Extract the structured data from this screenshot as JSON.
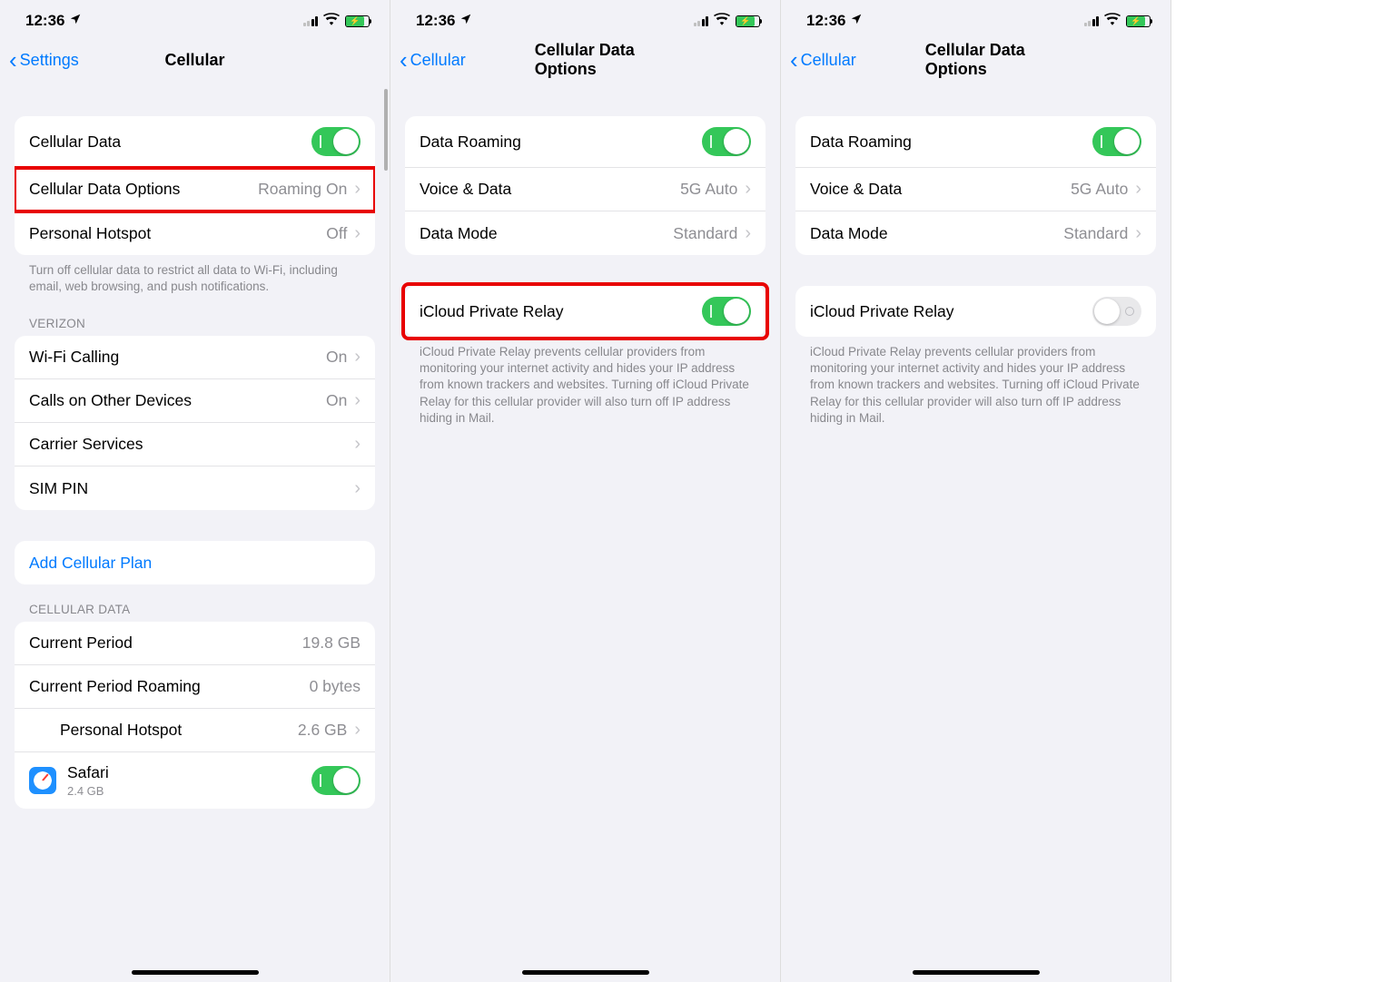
{
  "status": {
    "time": "12:36"
  },
  "screen1": {
    "back": "Settings",
    "title": "Cellular",
    "group1": {
      "cellular_data": "Cellular Data",
      "cellular_data_options": "Cellular Data Options",
      "cellular_data_options_detail": "Roaming On",
      "personal_hotspot": "Personal Hotspot",
      "personal_hotspot_detail": "Off"
    },
    "group1_footer": "Turn off cellular data to restrict all data to Wi-Fi, including email, web browsing, and push notifications.",
    "carrier_header": "VERIZON",
    "group2": {
      "wifi_calling": "Wi-Fi Calling",
      "wifi_calling_detail": "On",
      "calls_other": "Calls on Other Devices",
      "calls_other_detail": "On",
      "carrier_services": "Carrier Services",
      "sim_pin": "SIM PIN"
    },
    "add_plan": "Add Cellular Plan",
    "data_header": "CELLULAR DATA",
    "group3": {
      "current_period": "Current Period",
      "current_period_val": "19.8 GB",
      "roaming": "Current Period Roaming",
      "roaming_val": "0 bytes",
      "hotspot": "Personal Hotspot",
      "hotspot_val": "2.6 GB",
      "safari": "Safari",
      "safari_val": "2.4 GB"
    }
  },
  "screen2": {
    "back": "Cellular",
    "title": "Cellular Data Options",
    "group1": {
      "data_roaming": "Data Roaming",
      "voice_data": "Voice & Data",
      "voice_data_detail": "5G Auto",
      "data_mode": "Data Mode",
      "data_mode_detail": "Standard"
    },
    "group2": {
      "private_relay": "iCloud Private Relay"
    },
    "relay_footer": "iCloud Private Relay prevents cellular providers from monitoring your internet activity and hides your IP address from known trackers and websites. Turning off iCloud Private Relay for this cellular provider will also turn off IP address hiding in Mail."
  },
  "screen3": {
    "back": "Cellular",
    "title": "Cellular Data Options",
    "group1": {
      "data_roaming": "Data Roaming",
      "voice_data": "Voice & Data",
      "voice_data_detail": "5G Auto",
      "data_mode": "Data Mode",
      "data_mode_detail": "Standard"
    },
    "group2": {
      "private_relay": "iCloud Private Relay"
    },
    "relay_footer": "iCloud Private Relay prevents cellular providers from monitoring your internet activity and hides your IP address from known trackers and websites. Turning off iCloud Private Relay for this cellular provider will also turn off IP address hiding in Mail."
  }
}
